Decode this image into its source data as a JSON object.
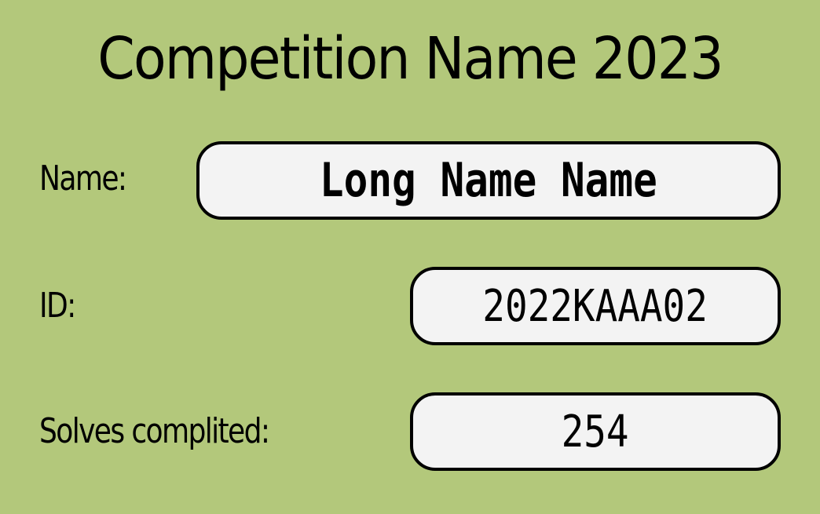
{
  "title": "Competition Name 2023",
  "fields": {
    "name": {
      "label": "Name:",
      "value": "Long Name Name"
    },
    "id": {
      "label": "ID:",
      "value": "2022KAAA02"
    },
    "solves": {
      "label": "Solves complited:",
      "value": "254"
    }
  },
  "colors": {
    "background": "#b3c87b",
    "field_fill": "#f3f3f3",
    "border": "#000000"
  }
}
